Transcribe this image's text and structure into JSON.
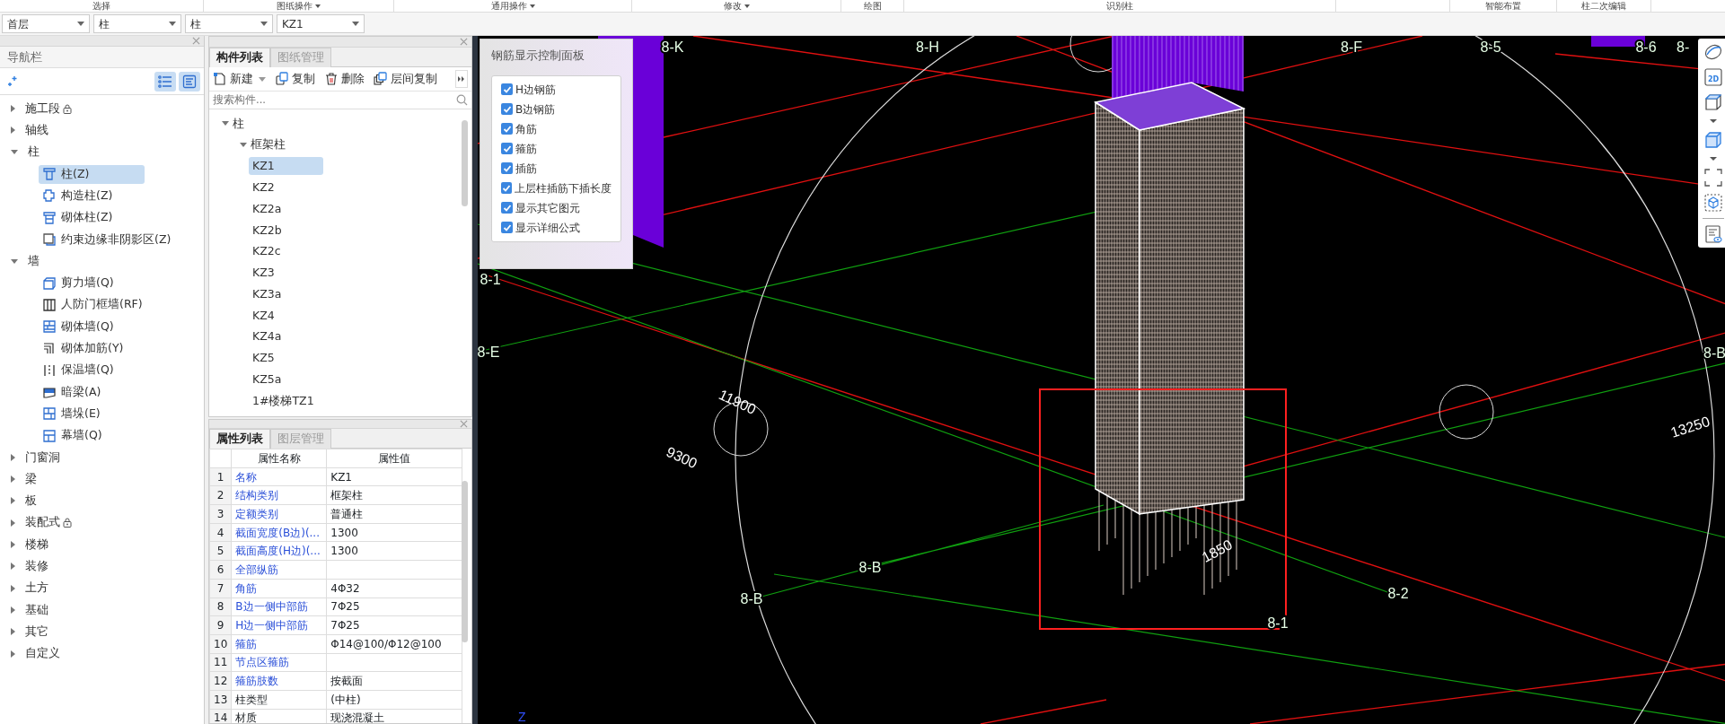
{
  "ribbon_groups": [
    {
      "label": "选择",
      "dropdown": false
    },
    {
      "label": "图纸操作",
      "dropdown": true
    },
    {
      "label": "通用操作",
      "dropdown": true
    },
    {
      "label": "修改",
      "dropdown": true
    },
    {
      "label": "绘图",
      "dropdown": false
    },
    {
      "label": "识别柱",
      "dropdown": false
    },
    {
      "label": "智能布置",
      "dropdown": false
    },
    {
      "label": "柱二次编辑",
      "dropdown": false
    }
  ],
  "selectors": [
    {
      "value": "首层"
    },
    {
      "value": "柱"
    },
    {
      "value": "柱"
    },
    {
      "value": "KZ1"
    }
  ],
  "navigator": {
    "title": "导航栏",
    "items": [
      {
        "label": "施工段",
        "locked": true,
        "expanded": false
      },
      {
        "label": "轴线",
        "locked": false,
        "expanded": false
      },
      {
        "label": "柱",
        "locked": false,
        "expanded": true,
        "children": [
          {
            "label": "柱(Z)",
            "kind": "column",
            "selected": true
          },
          {
            "label": "构造柱(Z)",
            "kind": "tie-column",
            "selected": false
          },
          {
            "label": "砌体柱(Z)",
            "kind": "masonry-column",
            "selected": false
          },
          {
            "label": "约束边缘非阴影区(Z)",
            "kind": "edge-zone",
            "selected": false
          }
        ]
      },
      {
        "label": "墙",
        "locked": false,
        "expanded": true,
        "children": [
          {
            "label": "剪力墙(Q)",
            "kind": "shear-wall",
            "selected": false
          },
          {
            "label": "人防门框墙(RF)",
            "kind": "door-frame-wall",
            "selected": false
          },
          {
            "label": "砌体墙(Q)",
            "kind": "masonry-wall",
            "selected": false
          },
          {
            "label": "砌体加筋(Y)",
            "kind": "wall-rebar",
            "selected": false
          },
          {
            "label": "保温墙(Q)",
            "kind": "insulation-wall",
            "selected": false
          },
          {
            "label": "暗梁(A)",
            "kind": "hidden-beam",
            "selected": false
          },
          {
            "label": "墙垛(E)",
            "kind": "wall-pier",
            "selected": false
          },
          {
            "label": "幕墙(Q)",
            "kind": "curtain-wall",
            "selected": false
          }
        ]
      },
      {
        "label": "门窗洞",
        "locked": false,
        "expanded": false
      },
      {
        "label": "梁",
        "locked": false,
        "expanded": false
      },
      {
        "label": "板",
        "locked": false,
        "expanded": false
      },
      {
        "label": "装配式",
        "locked": true,
        "expanded": false
      },
      {
        "label": "楼梯",
        "locked": false,
        "expanded": false
      },
      {
        "label": "装修",
        "locked": false,
        "expanded": false
      },
      {
        "label": "土方",
        "locked": false,
        "expanded": false
      },
      {
        "label": "基础",
        "locked": false,
        "expanded": false
      },
      {
        "label": "其它",
        "locked": false,
        "expanded": false
      },
      {
        "label": "自定义",
        "locked": false,
        "expanded": false
      }
    ]
  },
  "component_list": {
    "tabs": [
      {
        "label": "构件列表",
        "selected": true
      },
      {
        "label": "图纸管理",
        "selected": false
      }
    ],
    "toolbar": [
      {
        "label": "新建",
        "kind": "new",
        "dropdown": true
      },
      {
        "label": "复制",
        "kind": "copy",
        "dropdown": false
      },
      {
        "label": "删除",
        "kind": "delete",
        "dropdown": false
      },
      {
        "label": "层间复制",
        "kind": "floor-copy",
        "dropdown": false
      }
    ],
    "search": {
      "placeholder": "搜索构件..."
    },
    "tree": [
      {
        "label": "柱",
        "expanded": true,
        "children": [
          {
            "label": "框架柱",
            "expanded": true,
            "children": [
              {
                "label": "KZ1",
                "selected": true
              },
              {
                "label": "KZ2",
                "selected": false
              },
              {
                "label": "KZ2a",
                "selected": false
              },
              {
                "label": "KZ2b",
                "selected": false
              },
              {
                "label": "KZ2c",
                "selected": false
              },
              {
                "label": "KZ3",
                "selected": false
              },
              {
                "label": "KZ3a",
                "selected": false
              },
              {
                "label": "KZ4",
                "selected": false
              },
              {
                "label": "KZ4a",
                "selected": false
              },
              {
                "label": "KZ5",
                "selected": false
              },
              {
                "label": "KZ5a",
                "selected": false
              },
              {
                "label": "1#楼梯TZ1",
                "selected": false
              }
            ]
          }
        ]
      }
    ]
  },
  "properties": {
    "tabs": [
      {
        "label": "属性列表",
        "selected": true
      },
      {
        "label": "图层管理",
        "selected": false
      }
    ],
    "columns": [
      "属性名称",
      "属性值"
    ],
    "rows": [
      {
        "index": "1",
        "name": "名称",
        "value": "KZ1",
        "public": true
      },
      {
        "index": "2",
        "name": "结构类别",
        "value": "框架柱",
        "public": true
      },
      {
        "index": "3",
        "name": "定额类别",
        "value": "普通柱",
        "public": true
      },
      {
        "index": "4",
        "name": "截面宽度(B边)(...",
        "value": "1300",
        "public": true
      },
      {
        "index": "5",
        "name": "截面高度(H边)(...",
        "value": "1300",
        "public": true
      },
      {
        "index": "6",
        "name": "全部纵筋",
        "value": "",
        "public": true
      },
      {
        "index": "7",
        "name": "角筋",
        "value": "4Φ32",
        "public": true
      },
      {
        "index": "8",
        "name": "B边一侧中部筋",
        "value": "7Φ25",
        "public": true
      },
      {
        "index": "9",
        "name": "H边一侧中部筋",
        "value": "7Φ25",
        "public": true
      },
      {
        "index": "10",
        "name": "箍筋",
        "value": "Φ14@100/Φ12@100",
        "public": true
      },
      {
        "index": "11",
        "name": "节点区箍筋",
        "value": "",
        "public": true
      },
      {
        "index": "12",
        "name": "箍筋肢数",
        "value": "按截面",
        "public": true
      },
      {
        "index": "13",
        "name": "柱类型",
        "value": "(中柱)",
        "public": false
      },
      {
        "index": "14",
        "name": "材质",
        "value": "现浇混凝土",
        "public": false
      }
    ]
  },
  "rebar_panel": {
    "title": "钢筋显示控制面板",
    "options": [
      {
        "label": "H边钢筋",
        "checked": true
      },
      {
        "label": "B边钢筋",
        "checked": true
      },
      {
        "label": "角筋",
        "checked": true
      },
      {
        "label": "箍筋",
        "checked": true
      },
      {
        "label": "插筋",
        "checked": true
      },
      {
        "label": "上层柱插筋下插长度",
        "checked": true
      },
      {
        "label": "显示其它图元",
        "checked": true
      },
      {
        "label": "显示详细公式",
        "checked": true
      }
    ]
  },
  "canvas": {
    "axis_labels": [
      "8-K",
      "8-H",
      "8-F",
      "8-5",
      "8-6",
      "8-",
      "8-1",
      "8-E",
      "8-B",
      "8-B",
      "8-B",
      "8-2",
      "8-1"
    ],
    "dimension_labels": [
      "11900",
      "9300",
      "13250",
      "1850"
    ],
    "coordinate_axis": "Z"
  },
  "view_toolbar": {
    "view_2d_label": "2D"
  }
}
